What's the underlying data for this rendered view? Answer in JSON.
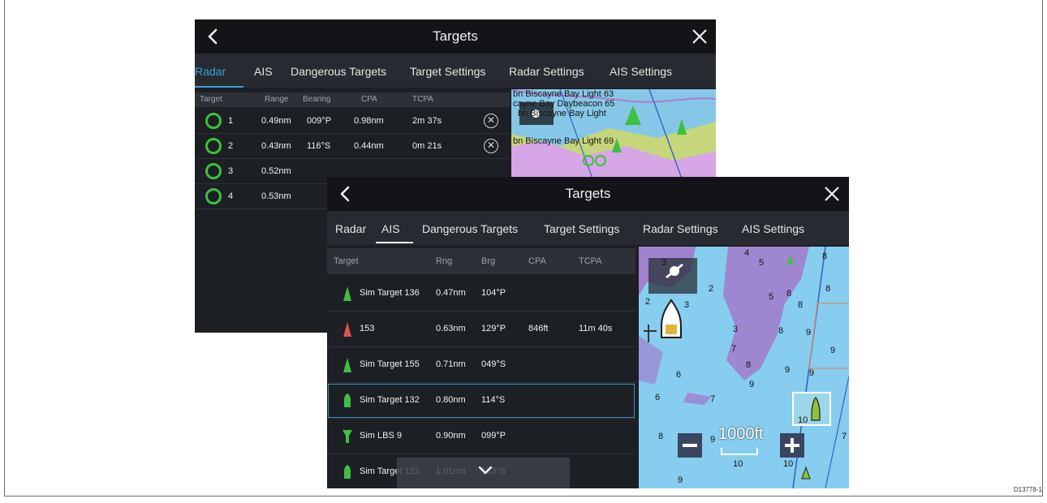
{
  "doc_id": "D13778-1",
  "back_panel": {
    "title": "Targets",
    "tabs": [
      "Radar",
      "AIS",
      "Dangerous Targets",
      "Target Settings",
      "Radar Settings",
      "AIS Settings"
    ],
    "active_tab": "Radar",
    "columns": [
      "Target",
      "Range",
      "Bearing",
      "CPA",
      "TCPA"
    ],
    "rows": [
      {
        "id": "1",
        "range": "0.49nm",
        "bearing": "009°P",
        "cpa": "0.98nm",
        "tcpa": "2m 37s"
      },
      {
        "id": "2",
        "range": "0.43nm",
        "bearing": "116°S",
        "cpa": "0.44nm",
        "tcpa": "0m 21s"
      },
      {
        "id": "3",
        "range": "0.52nm",
        "bearing": "",
        "cpa": "",
        "tcpa": ""
      },
      {
        "id": "4",
        "range": "0.53nm",
        "bearing": "",
        "cpa": "",
        "tcpa": ""
      }
    ],
    "map_labels": [
      "bn Biscayne Bay Light 63",
      "cayne Bay Daybeacon 65",
      "bn Biscayne Bay Light",
      "bn Biscayne Bay Light 69"
    ]
  },
  "front_panel": {
    "title": "Targets",
    "tabs": [
      "Radar",
      "AIS",
      "Dangerous Targets",
      "Target Settings",
      "Radar Settings",
      "AIS Settings"
    ],
    "active_tab": "AIS",
    "columns": [
      "Target",
      "Rng",
      "Brg",
      "CPA",
      "TCPA"
    ],
    "rows": [
      {
        "name": "Sim Target 136",
        "rng": "0.47nm",
        "brg": "104°P",
        "cpa": "",
        "tcpa": "",
        "icon": "ais-green-triangle-icon",
        "color": "#3fbf3f"
      },
      {
        "name": "153",
        "rng": "0.63nm",
        "brg": "129°P",
        "cpa": "846ft",
        "tcpa": "11m 40s",
        "icon": "ais-red-triangle-icon",
        "color": "#e05050"
      },
      {
        "name": "Sim Target 155",
        "rng": "0.71nm",
        "brg": "049°S",
        "cpa": "",
        "tcpa": "",
        "icon": "ais-green-triangle-icon",
        "color": "#3fbf3f"
      },
      {
        "name": "Sim Target 132",
        "rng": "0.80nm",
        "brg": "114°S",
        "cpa": "",
        "tcpa": "",
        "icon": "ais-green-vessel-icon",
        "color": "#3fbf3f",
        "selected": true
      },
      {
        "name": "Sim LBS 9",
        "rng": "0.90nm",
        "brg": "099°P",
        "cpa": "",
        "tcpa": "",
        "icon": "lbs-funnel-icon",
        "color": "#3fbf3f"
      },
      {
        "name": "Sim Target 122",
        "rng": "1.01nm",
        "brg": "133°S",
        "cpa": "",
        "tcpa": "",
        "icon": "ais-green-vessel-icon",
        "color": "#3fbf3f"
      }
    ],
    "map": {
      "scale_label": "1000ft",
      "depth_numbers": [
        "3",
        "2",
        "4",
        "5",
        "8",
        "8",
        "8",
        "2",
        "3",
        "5",
        "8",
        "3",
        "8",
        "9",
        "7",
        "9",
        "6",
        "8",
        "9",
        "9",
        "6",
        "7",
        "9",
        "8",
        "9",
        "10",
        "10",
        "10",
        "7",
        "9"
      ]
    }
  },
  "colors": {
    "accent": "#3aa0d8",
    "panel": "#1c1f24",
    "titlebar": "#121417",
    "water": "#7fc8ee",
    "radar_ring": "#3cc23c"
  }
}
